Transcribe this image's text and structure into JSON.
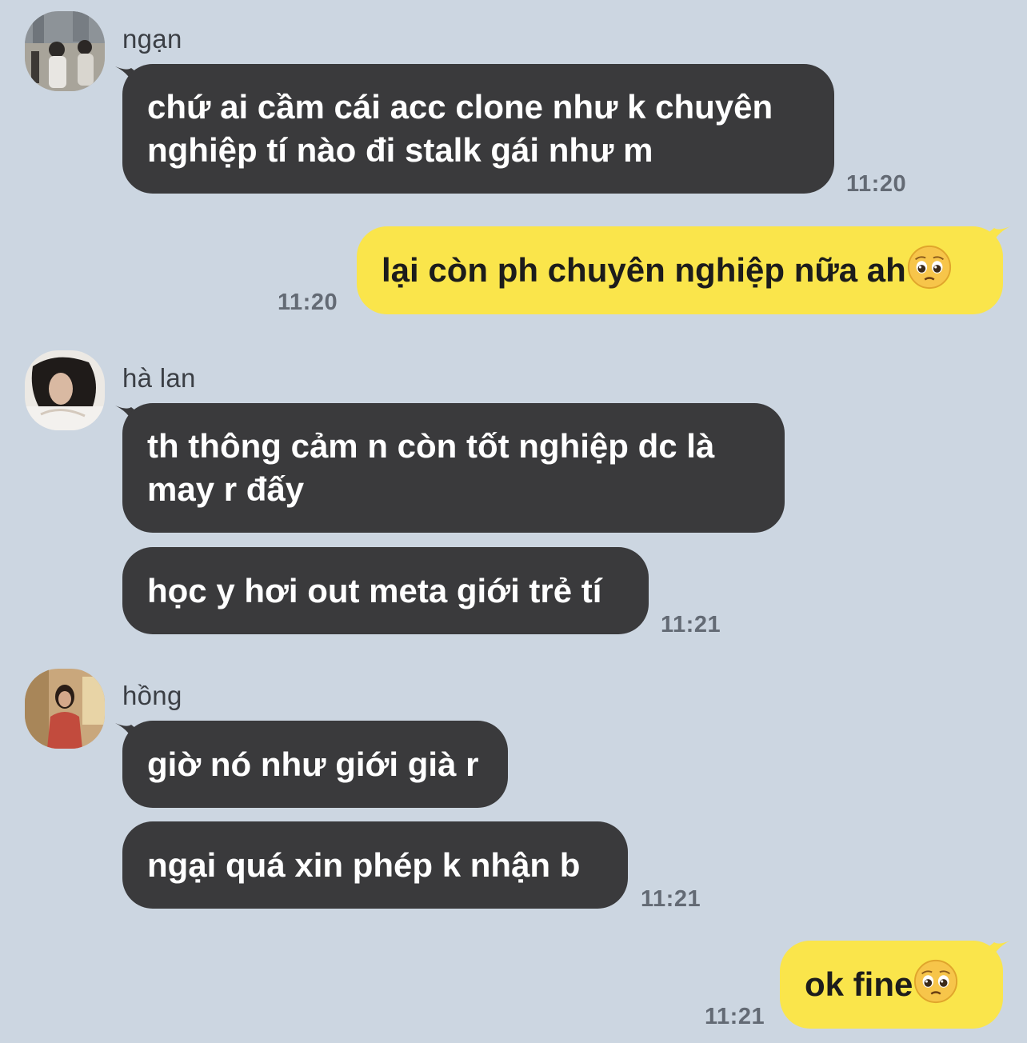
{
  "messages": [
    {
      "sender": "ngạn",
      "text": "chứ ai cầm cái acc clone như k chuyên\nnghiệp tí nào đi stalk gái như m",
      "time": "11:20"
    },
    {
      "text": "lại còn ph chuyên nghiệp nữa ah",
      "emoji": "pleading-face",
      "time": "11:20"
    },
    {
      "sender": "hà lan",
      "text": "th thông cảm n còn tốt nghiệp dc là\nmay r đấy"
    },
    {
      "text": "học y hơi out meta giới trẻ tí",
      "time": "11:21"
    },
    {
      "sender": "hồng",
      "text": "giờ nó như giới già r"
    },
    {
      "text": "ngại quá xin phép k nhận b",
      "time": "11:21"
    },
    {
      "text": "ok fine ",
      "emoji": "pleading-face",
      "time": "11:21"
    }
  ],
  "colors": {
    "background": "#ccd6e1",
    "incoming_bubble": "#3a3a3c",
    "outgoing_bubble": "#fae54b"
  }
}
